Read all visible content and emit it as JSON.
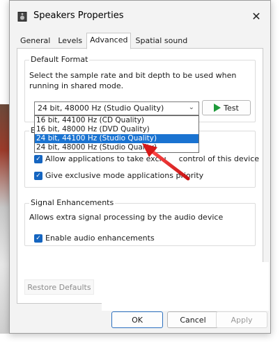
{
  "window": {
    "title": "Speakers Properties",
    "close_label": "✕"
  },
  "tabs": [
    {
      "label": "General"
    },
    {
      "label": "Levels"
    },
    {
      "label": "Advanced"
    },
    {
      "label": "Spatial sound"
    }
  ],
  "default_format": {
    "group_title": "Default Format",
    "description": "Select the sample rate and bit depth to be used when running in shared mode.",
    "selected_value": "24 bit, 48000 Hz (Studio Quality)",
    "test_label": "Test",
    "options": [
      "16 bit, 44100 Hz (CD Quality)",
      "16 bit, 48000 Hz (DVD Quality)",
      "24 bit, 44100 Hz (Studio Quality)",
      "24 bit, 48000 Hz (Studio Quality)"
    ],
    "highlighted_option_index": 2
  },
  "exclusive_mode": {
    "group_title_fragment": "E",
    "allow_label": "Allow applications to take exclusive control of this device",
    "allow_label_left": "Allow applications to take exclu",
    "allow_label_right": "control of this device",
    "priority_label": "Give exclusive mode applications priority",
    "allow_checked": true,
    "priority_checked": true
  },
  "signal_enhancements": {
    "group_title": "Signal Enhancements",
    "description": "Allows extra signal processing by the audio device",
    "enable_label": "Enable audio enhancements",
    "enable_checked": true
  },
  "footer": {
    "restore_label": "Restore Defaults",
    "ok_label": "OK",
    "cancel_label": "Cancel",
    "apply_label": "Apply"
  },
  "colors": {
    "accent": "#1565c0",
    "highlight": "#1a73d1",
    "annotation_arrow": "#e02020",
    "play_icon": "#1e9a3a"
  }
}
